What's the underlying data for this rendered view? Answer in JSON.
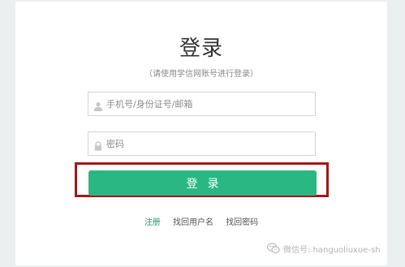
{
  "login": {
    "title": "登录",
    "subtitle": "（请使用学信网账号进行登录）",
    "username": {
      "placeholder": "手机号/身份证号/邮箱",
      "icon": "user-icon"
    },
    "password": {
      "placeholder": "密码",
      "icon": "lock-icon"
    },
    "submit_label": "登录",
    "links": {
      "register": "注册",
      "find_username": "找回用户名",
      "find_password": "找回密码"
    }
  },
  "watermark": {
    "icon": "wechat-icon",
    "text": "微信号: hanguoliuxue-sh"
  },
  "colors": {
    "accent": "#2ab784",
    "highlight_border": "#9e1a1a",
    "background": "#ecefef"
  }
}
